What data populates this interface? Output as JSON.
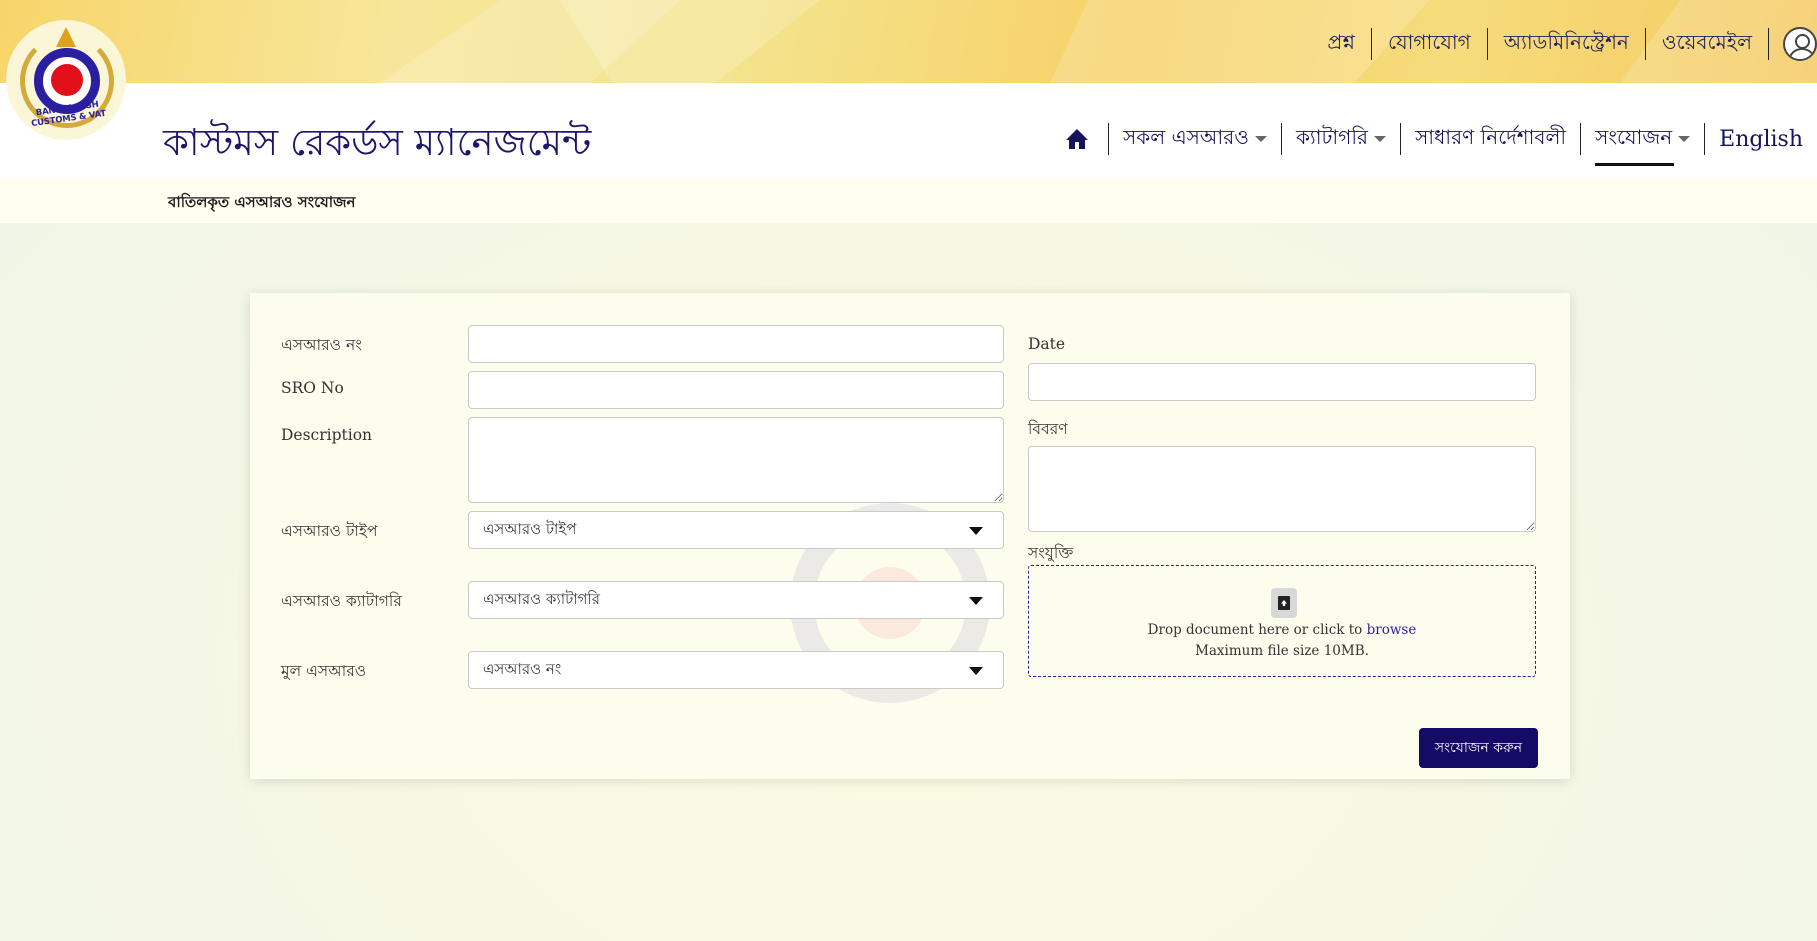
{
  "top_links": {
    "question": "প্রশ্ন",
    "contact": "যোগাযোগ",
    "administration": "অ্যাডমিনিস্ট্রেশন",
    "webmail": "ওয়েবমেইল"
  },
  "logo": {
    "text": "BANGLADESH CUSTOMS & VAT"
  },
  "header": {
    "site_title": "কাস্টমস রেকর্ডস ম্যানেজমেন্ট"
  },
  "nav": {
    "all_sro": "সকল এসআরও",
    "category": "ক্যাটাগরি",
    "general_instructions": "সাধারণ নির্দেশাবলী",
    "add": "সংযোজন",
    "language": "English"
  },
  "breadcrumb": "বাতিলকৃত এসআরও সংযোজন",
  "form": {
    "sro_no_bn_label": "এসআরও নং",
    "sro_no_bn_value": "",
    "sro_no_en_label": "SRO No",
    "sro_no_en_value": "",
    "description_label": "Description",
    "description_value": "",
    "sro_type_label": "এসআরও টাইপ",
    "sro_type_selected": "এসআরও টাইপ",
    "sro_category_label": "এসআরও ক্যাটাগরি",
    "sro_category_selected": "এসআরও ক্যাটাগরি",
    "original_sro_label": "মুল এসআরও",
    "original_sro_selected": "এসআরও নং",
    "date_label": "Date",
    "date_value": "",
    "details_label": "বিবরণ",
    "details_value": "",
    "attachment_label": "সংযুক্তি",
    "dropzone_text": "Drop document here or click to",
    "dropzone_browse": "browse",
    "dropzone_limit": "Maximum file size 10MB.",
    "submit_label": "সংযোজন করুন"
  },
  "colors": {
    "primary": "#140b66",
    "accent_red": "#e3101c",
    "header_gold": "#f7d56a"
  }
}
